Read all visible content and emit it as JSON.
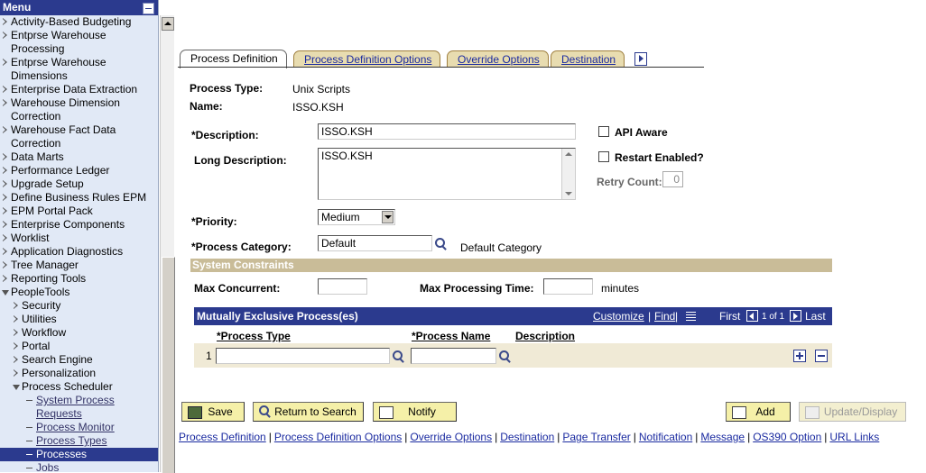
{
  "menu": {
    "title": "Menu",
    "items": [
      {
        "label": "Activity-Based Budgeting"
      },
      {
        "label": "Entprse Warehouse"
      },
      {
        "label": "Processing"
      },
      {
        "label": "Entprse Warehouse"
      },
      {
        "label": "Dimensions"
      },
      {
        "label": "Enterprise Data Extraction"
      },
      {
        "label": "Warehouse Dimension"
      },
      {
        "label": "Correction"
      },
      {
        "label": "Warehouse Fact Data"
      },
      {
        "label": "Correction"
      },
      {
        "label": "Data Marts"
      },
      {
        "label": "Performance Ledger"
      },
      {
        "label": "Upgrade Setup"
      },
      {
        "label": "Define Business Rules EPM"
      },
      {
        "label": "EPM Portal Pack"
      },
      {
        "label": "Enterprise Components"
      },
      {
        "label": "Worklist"
      },
      {
        "label": "Application Diagnostics"
      },
      {
        "label": "Tree Manager"
      },
      {
        "label": "Reporting Tools"
      },
      {
        "label": "PeopleTools"
      },
      {
        "label": "Security"
      },
      {
        "label": "Utilities"
      },
      {
        "label": "Workflow"
      },
      {
        "label": "Portal"
      },
      {
        "label": "Search Engine"
      },
      {
        "label": "Personalization"
      },
      {
        "label": "Process Scheduler"
      },
      {
        "label": "System Process"
      },
      {
        "label": "Requests"
      },
      {
        "label": "Process Monitor"
      },
      {
        "label": "Process Types"
      },
      {
        "label": "Processes"
      },
      {
        "label": "Jobs"
      }
    ]
  },
  "tabs": [
    {
      "label": "Process Definition"
    },
    {
      "label": "Process Definition Options"
    },
    {
      "label": "Override Options"
    },
    {
      "label": "Destination"
    }
  ],
  "form": {
    "process_type_label": "Process Type:",
    "process_type_value": "Unix Scripts",
    "name_label": "Name:",
    "name_value": "ISSO.KSH",
    "description_label": "*Description:",
    "description_value": "ISSO.KSH",
    "long_description_label": "Long Description:",
    "long_description_value": "ISSO.KSH",
    "api_aware_label": "API Aware",
    "restart_enabled_label": "Restart Enabled?",
    "retry_count_label": "Retry Count:",
    "retry_count_value": "0",
    "priority_label": "*Priority:",
    "priority_value": "Medium",
    "process_category_label": "*Process Category:",
    "process_category_value": "Default",
    "process_category_desc": "Default Category",
    "system_constraints_title": "System Constraints",
    "max_concurrent_label": "Max Concurrent:",
    "max_processing_time_label": "Max Processing Time:",
    "minutes_label": "minutes"
  },
  "grid": {
    "title": "Mutually Exclusive Process(es)",
    "customize": "Customize",
    "find": "Find",
    "first": "First",
    "range": "1 of 1",
    "last": "Last",
    "col_process_type": "*Process Type",
    "col_process_name": "*Process Name",
    "col_description": "Description",
    "row_number": "1"
  },
  "buttons": {
    "save": "Save",
    "return_to_search": "Return to Search",
    "notify": "Notify",
    "add": "Add",
    "update_display": "Update/Display"
  },
  "footer_links": [
    "Process Definition",
    "Process Definition Options",
    "Override Options",
    "Destination",
    "Page Transfer",
    "Notification",
    "Message",
    "OS390 Option",
    "URL Links"
  ]
}
